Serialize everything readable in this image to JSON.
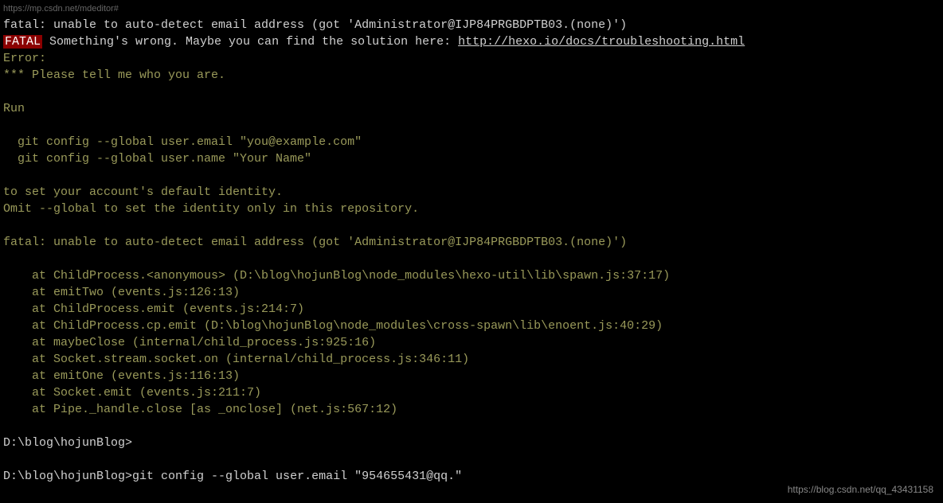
{
  "url_bar": "https://mp.csdn.net/mdeditor#",
  "lines": {
    "line1": "fatal: unable to auto-detect email address (got 'Administrator@IJP84PRGBDPTB03.(none)')",
    "fatal_badge": "FATAL",
    "line2_rest": " Something's wrong. Maybe you can find the solution here: ",
    "line2_link": "http://hexo.io/docs/troubleshooting.html",
    "line3": "Error:",
    "line4": "*** Please tell me who you are.",
    "line5": "",
    "line6": "Run",
    "line7": "",
    "line8": "  git config --global user.email \"you@example.com\"",
    "line9": "  git config --global user.name \"Your Name\"",
    "line10": "",
    "line11": "to set your account's default identity.",
    "line12": "Omit --global to set the identity only in this repository.",
    "line13": "",
    "line14": "fatal: unable to auto-detect email address (got 'Administrator@IJP84PRGBDPTB03.(none)')",
    "line15": "",
    "line16": "    at ChildProcess.<anonymous> (D:\\blog\\hojunBlog\\node_modules\\hexo-util\\lib\\spawn.js:37:17)",
    "line17": "    at emitTwo (events.js:126:13)",
    "line18": "    at ChildProcess.emit (events.js:214:7)",
    "line19": "    at ChildProcess.cp.emit (D:\\blog\\hojunBlog\\node_modules\\cross-spawn\\lib\\enoent.js:40:29)",
    "line20": "    at maybeClose (internal/child_process.js:925:16)",
    "line21": "    at Socket.stream.socket.on (internal/child_process.js:346:11)",
    "line22": "    at emitOne (events.js:116:13)",
    "line23": "    at Socket.emit (events.js:211:7)",
    "line24": "    at Pipe._handle.close [as _onclose] (net.js:567:12)",
    "line25": "",
    "prompt1": "D:\\blog\\hojunBlog>",
    "line26": "",
    "prompt2": "D:\\blog\\hojunBlog>",
    "cmd": "git config --global user.email \"954655431@qq.\""
  },
  "watermark": "https://blog.csdn.net/qq_43431158"
}
